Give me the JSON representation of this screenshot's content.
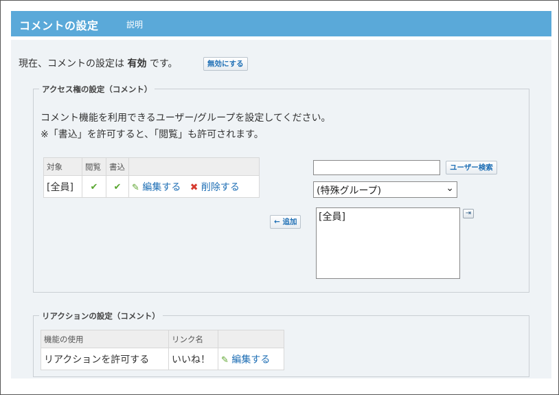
{
  "header": {
    "title": "コメントの設定",
    "help_label": "説明"
  },
  "status": {
    "prefix": "現在、コメントの設定は",
    "value": "有効",
    "suffix": "です。",
    "disable_label": "無効にする"
  },
  "access": {
    "legend": "アクセス権の設定（コメント）",
    "desc_line1": "コメント機能を利用できるユーザー/グループを設定してください。",
    "desc_line2": "※「書込」を許可すると、「閲覧」も許可されます。",
    "columns": {
      "target": "対象",
      "view": "閲覧",
      "write": "書込",
      "ops": ""
    },
    "rows": [
      {
        "target": "[全員]",
        "view": "✔",
        "write": "✔",
        "edit": "編集する",
        "delete": "削除する"
      }
    ],
    "user_search": {
      "value": "",
      "button_label": "ユーザー検索"
    },
    "group_select": {
      "selected": "(特殊グループ)"
    },
    "add_label": "← 追加",
    "candidates": [
      "[全員]"
    ]
  },
  "reaction": {
    "legend": "リアクションの設定（コメント）",
    "columns": {
      "use": "機能の使用",
      "name": "リンク名",
      "ops": ""
    },
    "rows": [
      {
        "use": "リアクションを許可する",
        "name": "いいね！",
        "edit": "編集する"
      }
    ]
  },
  "colors": {
    "header": "#5aa9d9",
    "panel": "#eff3f6",
    "link": "#1f6fb5"
  },
  "icons": [
    "check-icon",
    "pencil-icon",
    "delete-x-icon",
    "expand-arrow-icon",
    "dropdown-caret-icon"
  ]
}
